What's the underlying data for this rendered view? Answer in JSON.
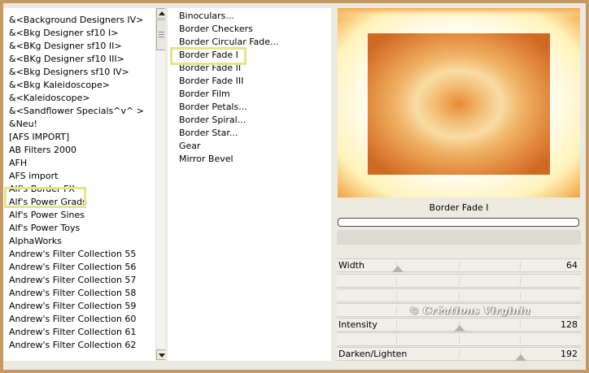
{
  "categories": [
    "&<Background Designers IV>",
    "&<Bkg Designer sf10 I>",
    "&<BKg Designer sf10 II>",
    "&<BKg Designer sf10 III>",
    "&<Bkg Designers sf10 IV>",
    "&<Bkg Kaleidoscope>",
    "&<Kaleidoscope>",
    "&<Sandflower Specials^v^ >",
    "&Neu!",
    "[AFS IMPORT]",
    "AB Filters 2000",
    "AFH",
    "AFS import",
    "Alf's Border FX",
    "Alf's Power Grads",
    "Alf's Power Sines",
    "Alf's Power Toys",
    "AlphaWorks",
    "Andrew's Filter Collection 55",
    "Andrew's Filter Collection 56",
    "Andrew's Filter Collection 57",
    "Andrew's Filter Collection 58",
    "Andrew's Filter Collection 59",
    "Andrew's Filter Collection 60",
    "Andrew's Filter Collection 61",
    "Andrew's Filter Collection 62"
  ],
  "selected_category": "Alf's Border FX",
  "effects": [
    "Binoculars...",
    "Border Checkers",
    "Border Circular Fade...",
    "Border Fade I",
    "Border Fade II",
    "Border Fade III",
    "Border Film",
    "Border Petals...",
    "Border Spiral...",
    "Border Star...",
    "Gear",
    "Mirror Bevel"
  ],
  "selected_effect": "Border Fade I",
  "filter_name": "Border Fade I",
  "progress": 0,
  "sliders": [
    {
      "label": "Width",
      "value": "64",
      "fraction": 0.251
    },
    {
      "label": "Intensity",
      "value": "128",
      "fraction": 0.502
    },
    {
      "label": "Darken/Lighten",
      "value": "192",
      "fraction": 0.753
    }
  ],
  "watermark": "© Créations Virginia",
  "colors": {
    "frame": "#c59a62",
    "panel_bg": "#ece9e1",
    "highlight": "#e2e58c",
    "preview_orange": "#e08a3a",
    "preview_glow": "#fff8d8"
  },
  "icons": {
    "scroll_up": "triangle-up",
    "scroll_down": "triangle-down"
  }
}
